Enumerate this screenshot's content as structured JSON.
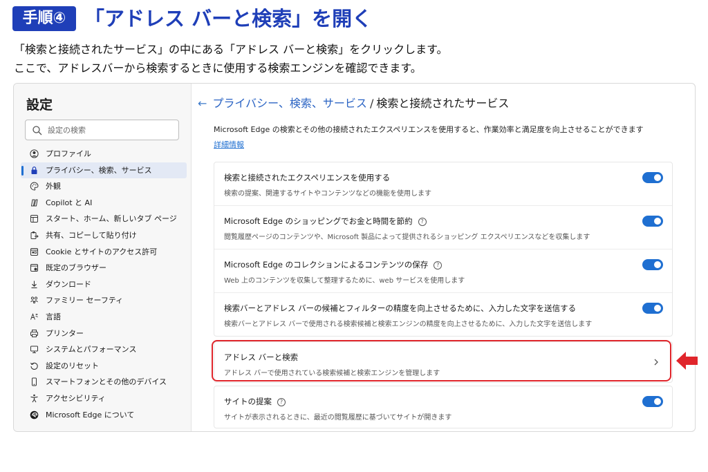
{
  "header": {
    "step_badge": "手順④",
    "title": "「アドレス バーと検索」を開く",
    "description_line1": "「検索と接続されたサービス」の中にある「アドレス バーと検索」をクリックします。",
    "description_line2": "ここで、アドレスバーから検索するときに使用する検索エンジンを確認できます。"
  },
  "sidebar": {
    "title": "設定",
    "search_placeholder": "設定の検索",
    "items": [
      {
        "label": "プロファイル",
        "icon": "profile-icon"
      },
      {
        "label": "プライバシー、検索、サービス",
        "icon": "lock-icon",
        "active": true
      },
      {
        "label": "外観",
        "icon": "palette-icon"
      },
      {
        "label": "Copilot と AI",
        "icon": "copilot-icon"
      },
      {
        "label": "スタート、ホーム、新しいタブ ページ",
        "icon": "window-icon"
      },
      {
        "label": "共有、コピーして貼り付け",
        "icon": "share-icon"
      },
      {
        "label": "Cookie とサイトのアクセス許可",
        "icon": "cookie-icon"
      },
      {
        "label": "既定のブラウザー",
        "icon": "browser-icon"
      },
      {
        "label": "ダウンロード",
        "icon": "download-icon"
      },
      {
        "label": "ファミリー セーフティ",
        "icon": "family-icon"
      },
      {
        "label": "言語",
        "icon": "language-icon"
      },
      {
        "label": "プリンター",
        "icon": "printer-icon"
      },
      {
        "label": "システムとパフォーマンス",
        "icon": "system-icon"
      },
      {
        "label": "設定のリセット",
        "icon": "reset-icon"
      },
      {
        "label": "スマートフォンとその他のデバイス",
        "icon": "phone-icon"
      },
      {
        "label": "アクセシビリティ",
        "icon": "accessibility-icon"
      },
      {
        "label": "Microsoft Edge について",
        "icon": "edge-icon"
      }
    ]
  },
  "main": {
    "breadcrumb_link": "プライバシー、検索、サービス",
    "breadcrumb_sep": "/",
    "breadcrumb_current": "検索と接続されたサービス",
    "intro": "Microsoft Edge の検索とその他の接続されたエクスペリエンスを使用すると、作業効率と満足度を向上させることができます",
    "learn_more": "詳細情報",
    "group1": [
      {
        "title": "検索と接続されたエクスペリエンスを使用する",
        "desc": "検索の提案、関連するサイトやコンテンツなどの機能を使用します",
        "toggle": true
      },
      {
        "title": "Microsoft Edge のショッピングでお金と時間を節約",
        "desc": "閲覧履歴ページのコンテンツや、Microsoft 製品によって提供されるショッピング エクスペリエンスなどを収集します",
        "toggle": true,
        "help": "?"
      },
      {
        "title": "Microsoft Edge のコレクションによるコンテンツの保存",
        "desc": "Web 上のコンテンツを収集して整理するために、web サービスを使用します",
        "toggle": true,
        "help": "?"
      },
      {
        "title": "検索バーとアドレス バーの候補とフィルターの精度を向上させるために、入力した文字を送信する",
        "desc": "検索バーとアドレス バーで使用される検索候補と検索エンジンの精度を向上させるために、入力した文字を送信します",
        "toggle": true
      }
    ],
    "address_bar_row": {
      "title": "アドレス バーと検索",
      "desc": "アドレス バーで使用されている検索候補と検索エンジンを管理します"
    },
    "site_suggestions_row": {
      "title": "サイトの提案",
      "desc": "サイトが表示されるときに、最近の閲覧履歴に基づいてサイトが開きます",
      "toggle": true,
      "help": "?"
    }
  },
  "colors": {
    "accent": "#1f3fb8",
    "toggle": "#1f6fd1",
    "highlight": "#e0252b"
  }
}
